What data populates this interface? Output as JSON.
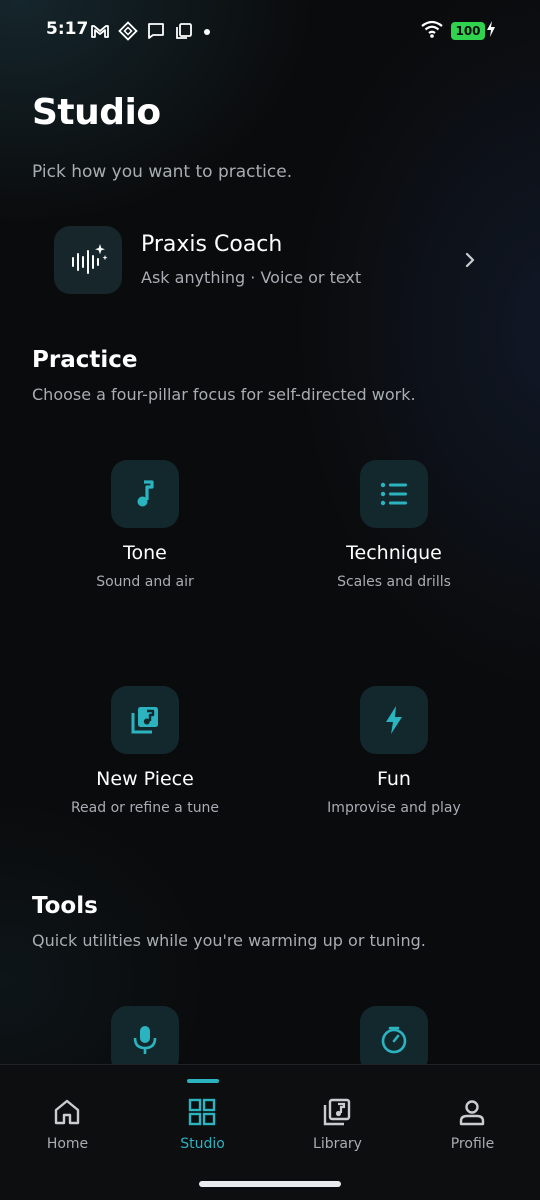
{
  "status_bar": {
    "time": "5:17",
    "battery": "100"
  },
  "header": {
    "title": "Studio",
    "subtitle": "Pick how you want to practice."
  },
  "coach": {
    "title": "Praxis Coach",
    "subtitle": "Ask anything · Voice or text"
  },
  "practice": {
    "title": "Practice",
    "subtitle": "Choose a four-pillar focus for self-directed work.",
    "items": [
      {
        "title": "Tone",
        "subtitle": "Sound and air",
        "icon": "music-note-icon"
      },
      {
        "title": "Technique",
        "subtitle": "Scales and drills",
        "icon": "list-icon"
      },
      {
        "title": "New Piece",
        "subtitle": "Read or refine a tune",
        "icon": "sheet-music-icon"
      },
      {
        "title": "Fun",
        "subtitle": "Improvise and play",
        "icon": "lightning-icon"
      }
    ]
  },
  "tools": {
    "title": "Tools",
    "subtitle": "Quick utilities while you're warming up or tuning.",
    "items": [
      {
        "icon": "microphone-icon"
      },
      {
        "icon": "timer-icon"
      }
    ]
  },
  "nav": {
    "items": [
      {
        "label": "Home",
        "icon": "home-icon",
        "active": false
      },
      {
        "label": "Studio",
        "icon": "grid-icon",
        "active": true
      },
      {
        "label": "Library",
        "icon": "library-icon",
        "active": false
      },
      {
        "label": "Profile",
        "icon": "profile-icon",
        "active": false
      }
    ]
  },
  "colors": {
    "accent": "#2bb3c0",
    "tile": "#13282c",
    "background": "#0a0b0c",
    "battery": "#2fd34e"
  }
}
